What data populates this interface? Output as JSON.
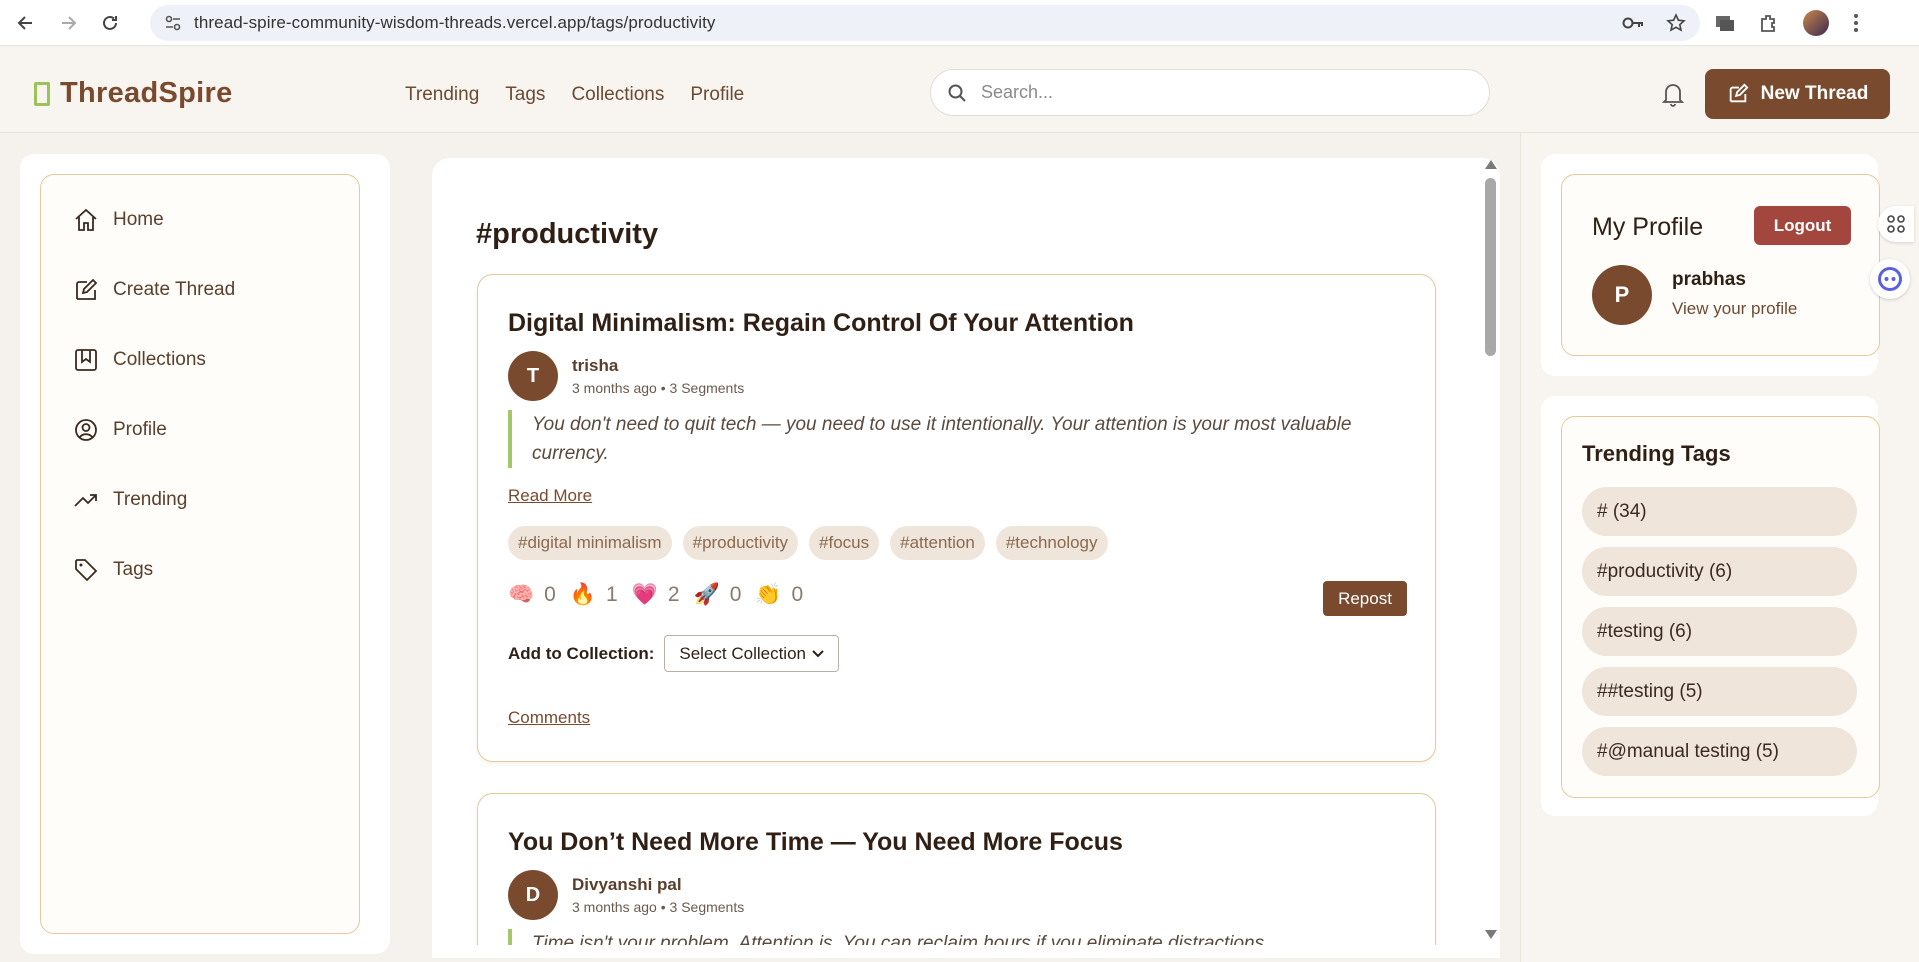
{
  "browser": {
    "url": "thread-spire-community-wisdom-threads.vercel.app/tags/productivity"
  },
  "header": {
    "logo_text": "ThreadSpire",
    "nav": [
      "Trending",
      "Tags",
      "Collections",
      "Profile"
    ],
    "search_placeholder": "Search...",
    "new_thread_label": "New Thread"
  },
  "sidebar": {
    "items": [
      {
        "label": "Home",
        "icon": "home-icon"
      },
      {
        "label": "Create Thread",
        "icon": "edit-icon"
      },
      {
        "label": "Collections",
        "icon": "bookmark-icon"
      },
      {
        "label": "Profile",
        "icon": "user-circle-icon"
      },
      {
        "label": "Trending",
        "icon": "trending-up-icon"
      },
      {
        "label": "Tags",
        "icon": "tag-icon"
      }
    ]
  },
  "main": {
    "title": "#productivity",
    "threads": [
      {
        "title": "Digital Minimalism: Regain Control Of Your Attention",
        "author_initial": "T",
        "author": "trisha",
        "meta": "3 months ago • 3 Segments",
        "quote": "You don't need to quit tech — you need to use it intentionally. Your attention is your most valuable currency.",
        "read_more": "Read More",
        "tags": [
          "#digital minimalism",
          "#productivity",
          "#focus",
          "#attention",
          "#technology"
        ],
        "reactions": [
          {
            "emoji": "🧠",
            "count": "0"
          },
          {
            "emoji": "🔥",
            "count": "1"
          },
          {
            "emoji": "💗",
            "count": "2"
          },
          {
            "emoji": "🚀",
            "count": "0"
          },
          {
            "emoji": "👏",
            "count": "0"
          }
        ],
        "repost_label": "Repost",
        "collection_label": "Add to Collection:",
        "collection_select": "Select Collection",
        "comments_label": "Comments"
      },
      {
        "title": "You Don’t Need More Time — You Need More Focus",
        "author_initial": "D",
        "author": "Divyanshi pal",
        "meta": "3 months ago • 3 Segments",
        "quote": "Time isn't your problem. Attention is. You can reclaim hours if you eliminate distractions."
      }
    ]
  },
  "profile": {
    "title": "My Profile",
    "logout_label": "Logout",
    "initial": "P",
    "name": "prabhas",
    "link": "View your profile"
  },
  "trending_tags": {
    "title": "Trending Tags",
    "tags": [
      "# (34)",
      "#productivity (6)",
      "#testing (6)",
      "##testing (5)",
      "#@manual testing (5)"
    ]
  },
  "colors": {
    "brand": "#7a4a2e",
    "accent_green": "#9cc25a",
    "logout": "#a3473e",
    "card_border": "#e4c99a",
    "chip_bg": "#efe5da"
  }
}
